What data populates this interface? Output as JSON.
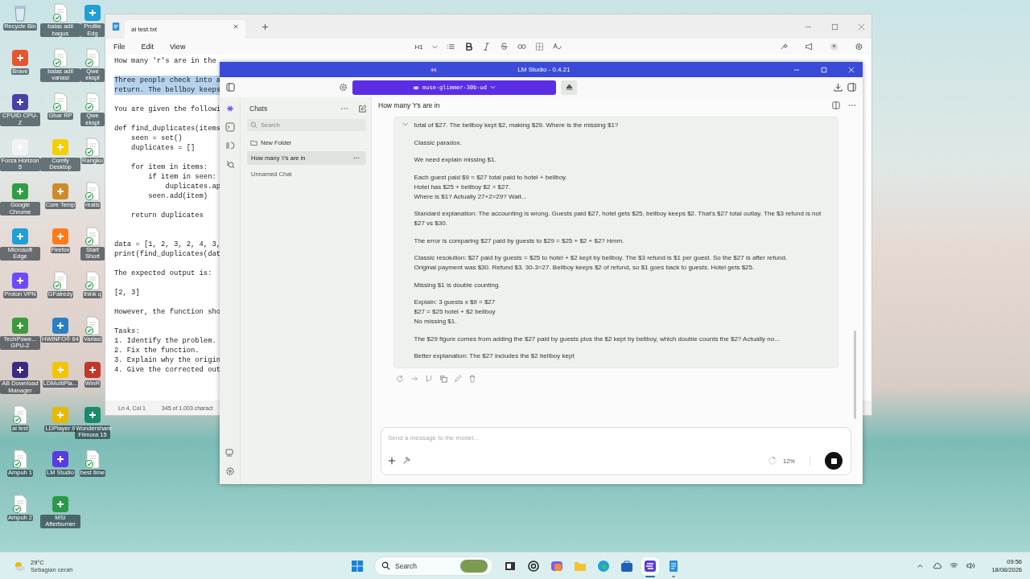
{
  "desktop_icons": [
    {
      "label": "Recycle Bin",
      "kind": "bin"
    },
    {
      "label": "Brave",
      "kind": "app",
      "color": "#e8542c"
    },
    {
      "label": "CPUID CPU-Z",
      "kind": "app",
      "color": "#4b3fa8"
    },
    {
      "label": "Forza Horizon 5",
      "kind": "app",
      "color": "#f2f2f2"
    },
    {
      "label": "Google Chrome",
      "kind": "app",
      "color": "#2f9e44"
    },
    {
      "label": "Microsoft Edge",
      "kind": "app",
      "color": "#1fa0d8"
    },
    {
      "label": "Proton VPN",
      "kind": "app",
      "color": "#6d4aff"
    },
    {
      "label": "TechPowe... GPU-Z",
      "kind": "app",
      "color": "#3c9a3c"
    },
    {
      "label": "AB Download Manager",
      "kind": "app",
      "color": "#3a2a80"
    },
    {
      "label": "ai test",
      "kind": "file"
    },
    {
      "label": "Ampuh 1",
      "kind": "file"
    },
    {
      "label": "Ampuh 2",
      "kind": "file"
    },
    {
      "label": "balas adil bagus",
      "kind": "file"
    },
    {
      "label": "balas adil variasi",
      "kind": "file"
    },
    {
      "label": "Ghar RP",
      "kind": "file"
    },
    {
      "label": "Comfy Desktop",
      "kind": "app",
      "color": "#f5d000"
    },
    {
      "label": "Core Temp",
      "kind": "app",
      "color": "#d08a2a"
    },
    {
      "label": "Firefox",
      "kind": "app",
      "color": "#ff7a1a"
    },
    {
      "label": "GFalredy",
      "kind": "file"
    },
    {
      "label": "HWiNFO® 64",
      "kind": "app",
      "color": "#2a7fc4"
    },
    {
      "label": "LDMultiPla...",
      "kind": "app",
      "color": "#f5c400"
    },
    {
      "label": "LDPlayer 9",
      "kind": "app",
      "color": "#e8b800"
    },
    {
      "label": "LM Studio",
      "kind": "app",
      "color": "#5a3be0"
    },
    {
      "label": "MSI Afterburner",
      "kind": "app",
      "color": "#2a9a4a"
    },
    {
      "label": "Profile Edg",
      "kind": "app",
      "color": "#1fa0d8"
    },
    {
      "label": "Qwe ekspl",
      "kind": "file"
    },
    {
      "label": "Qwe ekspl",
      "kind": "file"
    },
    {
      "label": "Rangku",
      "kind": "file"
    },
    {
      "label": "realis",
      "kind": "file"
    },
    {
      "label": "Start Short",
      "kind": "file"
    },
    {
      "label": "think q",
      "kind": "file"
    },
    {
      "label": "Variasi",
      "kind": "file"
    },
    {
      "label": "WinR",
      "kind": "app",
      "color": "#c0392b"
    },
    {
      "label": "Wondershare Filmora 15",
      "kind": "app",
      "color": "#1a8a6a"
    },
    {
      "label": "best time",
      "kind": "file"
    }
  ],
  "notepad": {
    "tab": "ai test.txt",
    "menu": [
      "File",
      "Edit",
      "View"
    ],
    "heading_control": "H1",
    "lines": [
      {
        "kind": "text",
        "text": "How many 'r's are in the",
        "selected": false
      },
      {
        "kind": "blank"
      },
      {
        "kind": "text",
        "text": "Three people check into a",
        "selected": true
      },
      {
        "kind": "text",
        "text": "return. The bellboy keeps",
        "selected": true
      },
      {
        "kind": "blank"
      },
      {
        "kind": "text",
        "text": "You are given the followi",
        "selected": false
      },
      {
        "kind": "blank"
      },
      {
        "kind": "text",
        "text": "def find_duplicates(items",
        "selected": false
      },
      {
        "kind": "text",
        "text": "    seen = set()",
        "selected": false
      },
      {
        "kind": "text",
        "text": "    duplicates = []",
        "selected": false
      },
      {
        "kind": "blank"
      },
      {
        "kind": "text",
        "text": "    for item in items:",
        "selected": false
      },
      {
        "kind": "text",
        "text": "        if item in seen:",
        "selected": false
      },
      {
        "kind": "text",
        "text": "            duplicates.ap",
        "selected": false
      },
      {
        "kind": "text",
        "text": "        seen.add(item)",
        "selected": false
      },
      {
        "kind": "blank"
      },
      {
        "kind": "text",
        "text": "    return duplicates",
        "selected": false
      },
      {
        "kind": "blank"
      },
      {
        "kind": "blank"
      },
      {
        "kind": "text",
        "text": "data = [1, 2, 3, 2, 4, 3,",
        "selected": false
      },
      {
        "kind": "text",
        "text": "print(find_duplicates(dat",
        "selected": false
      },
      {
        "kind": "blank"
      },
      {
        "kind": "text",
        "text": "The expected output is:",
        "selected": false
      },
      {
        "kind": "blank"
      },
      {
        "kind": "text",
        "text": "[2, 3]",
        "selected": false
      },
      {
        "kind": "blank"
      },
      {
        "kind": "text",
        "text": "However, the function sho",
        "selected": false
      },
      {
        "kind": "blank"
      },
      {
        "kind": "text",
        "text": "Tasks:",
        "selected": false
      },
      {
        "kind": "text",
        "text": "1. Identify the problem.",
        "selected": false
      },
      {
        "kind": "text",
        "text": "2. Fix the function.",
        "selected": false
      },
      {
        "kind": "text",
        "text": "3. Explain why the origin",
        "selected": false
      },
      {
        "kind": "text",
        "text": "4. Give the corrected out",
        "selected": false
      }
    ],
    "status": [
      "Ln 4, Col 1",
      "345 of 1.003 charact"
    ]
  },
  "lm_studio": {
    "title": "LM Studio - 0.4.21",
    "model": "muse-glimmer-30b-ud",
    "sidebar": {
      "title": "Chats",
      "search": {
        "placeholder": "Search"
      },
      "folder": "New Folder",
      "chats": [
        {
          "label": "How many 'r's are in",
          "selected": true
        },
        {
          "label": "Unnamed Chat",
          "selected": false
        }
      ]
    },
    "chat": {
      "title": "How many 'r's are in",
      "reasoning": {
        "expanded": true,
        "paragraphs": [
          [
            "total of $27. The bellboy kept $2, making $29. Where is the missing $1?"
          ],
          [
            "Classic paradox."
          ],
          [
            "We need explain missing $1."
          ],
          [
            "Each guest paid $9 = $27 total paid to hotel + bellboy.",
            "Hotel has $25 + bellboy $2 = $27.",
            "Where is $1? Actually 27+2=29? Wait..."
          ],
          [
            "Standard explanation: The accounting is wrong. Guests paid $27, hotel gets $25, bellboy keeps $2. That's $27 total outlay. The $3 refund is not $27 vs $30."
          ],
          [
            "The error is comparing $27 paid by guests to $29 = $25 + $2 + $2? Hmm."
          ],
          [
            "Classic resolution: $27 paid by guests = $25 to hotel + $2 kept by bellboy. The $3 refund is $1 per guest. So the $27 is after refund.",
            "Original payment was $30. Refund $3. 30-3=27. Bellboy keeps $2 of refund, so $1 goes back to guests. Hotel gets $25."
          ],
          [
            "Missing $1 is double counting."
          ],
          [
            "Explain: 3 guests x $9 = $27",
            "$27 = $25 hotel + $2 bellboy",
            "No missing $1."
          ],
          [
            "The $29 figure comes from adding the $27 paid by guests plus the $2 kept by bellboy, which double counts the $2? Actually no..."
          ],
          [
            "Better explanation: The $27 includes the $2 bellboy kept"
          ]
        ]
      },
      "composer": {
        "placeholder": "Send a message to the model...",
        "progress": "12%",
        "level": 0.12
      }
    }
  },
  "taskbar": {
    "weather": {
      "temp": "29°C",
      "condition": "Sebagian cerah"
    },
    "search": {
      "placeholder": "Search"
    },
    "apps": [
      {
        "kind": "task-view",
        "selected": false,
        "open": false
      },
      {
        "kind": "chatgpt",
        "selected": false,
        "open": false
      },
      {
        "kind": "copilot",
        "selected": false,
        "open": false
      },
      {
        "kind": "folder",
        "selected": false,
        "open": false
      },
      {
        "kind": "edge",
        "selected": false,
        "open": false
      },
      {
        "kind": "store",
        "selected": false,
        "open": false
      },
      {
        "kind": "lmstudio",
        "selected": true,
        "open": true
      },
      {
        "kind": "notepad",
        "selected": false,
        "open": true
      }
    ],
    "time": "09:56",
    "date": "18/08/2026"
  }
}
